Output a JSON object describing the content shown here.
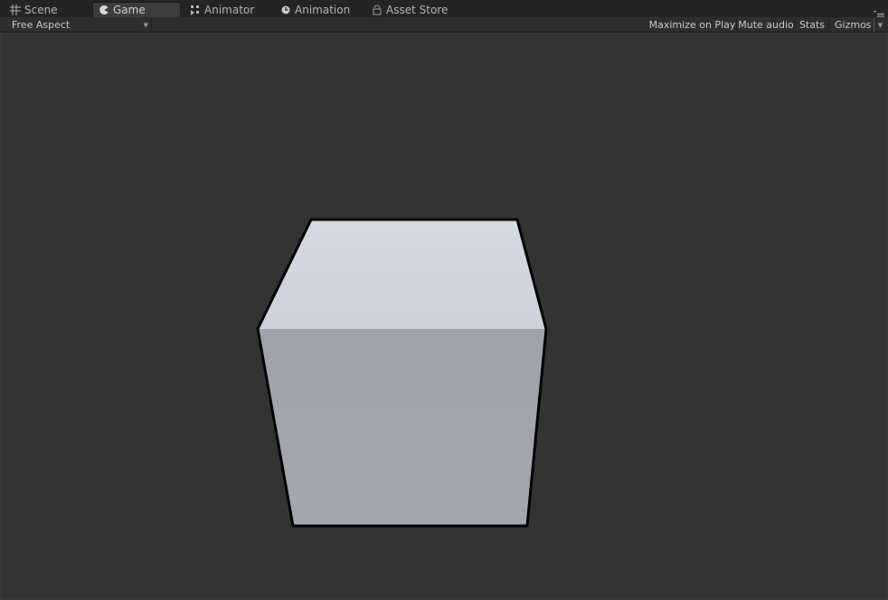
{
  "tabs": [
    {
      "label": "Scene",
      "icon": "grid-icon",
      "active": false
    },
    {
      "label": "Game",
      "icon": "pacman-icon",
      "active": true
    },
    {
      "label": "Animator",
      "icon": "animator-icon",
      "active": false
    },
    {
      "label": "Animation",
      "icon": "clock-icon",
      "active": false
    },
    {
      "label": "Asset Store",
      "icon": "store-icon",
      "active": false
    }
  ],
  "toolbar": {
    "aspect": "Free Aspect",
    "maximize_on_play": "Maximize on Play",
    "mute_audio": "Mute audio",
    "stats": "Stats",
    "gizmos": "Gizmos"
  },
  "colors": {
    "background": "#333333",
    "cube_top": "#d2d6de",
    "cube_front": "#a1a4ab",
    "cube_outline": "#000000"
  }
}
